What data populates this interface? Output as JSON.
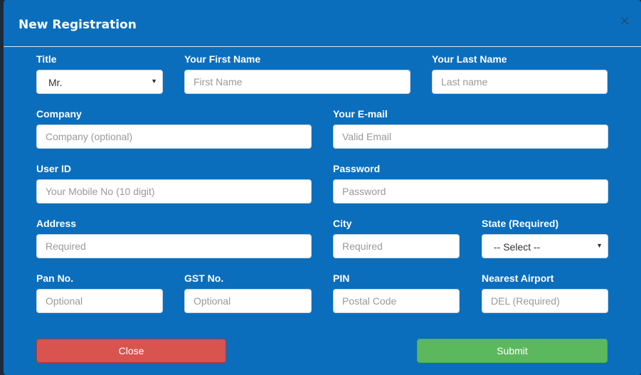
{
  "modal": {
    "title": "New Registration",
    "close_icon": "×"
  },
  "fields": {
    "title": {
      "label": "Title",
      "value": "Mr."
    },
    "first_name": {
      "label": "Your First Name",
      "placeholder": "First Name"
    },
    "last_name": {
      "label": "Your Last Name",
      "placeholder": "Last name"
    },
    "company": {
      "label": "Company",
      "placeholder": "Company (optional)"
    },
    "email": {
      "label": "Your E-mail",
      "placeholder": "Valid Email"
    },
    "user_id": {
      "label": "User ID",
      "placeholder": "Your Mobile No (10 digit)"
    },
    "password": {
      "label": "Password",
      "placeholder": "Password"
    },
    "address": {
      "label": "Address",
      "placeholder": "Required"
    },
    "city": {
      "label": "City",
      "placeholder": "Required"
    },
    "state": {
      "label": "State (Required)",
      "value": "-- Select --"
    },
    "pan": {
      "label": "Pan No.",
      "placeholder": "Optional"
    },
    "gst": {
      "label": "GST No.",
      "placeholder": "Optional"
    },
    "pin": {
      "label": "PIN",
      "placeholder": "Postal Code"
    },
    "airport": {
      "label": "Nearest Airport",
      "placeholder": "DEL (Required)"
    }
  },
  "buttons": {
    "close": "Close",
    "submit": "Submit"
  },
  "icons": {
    "caret": "▼"
  },
  "colors": {
    "modal_bg": "#0a6ebd",
    "close_button": "#d9534f",
    "submit_button": "#5cb85c"
  }
}
